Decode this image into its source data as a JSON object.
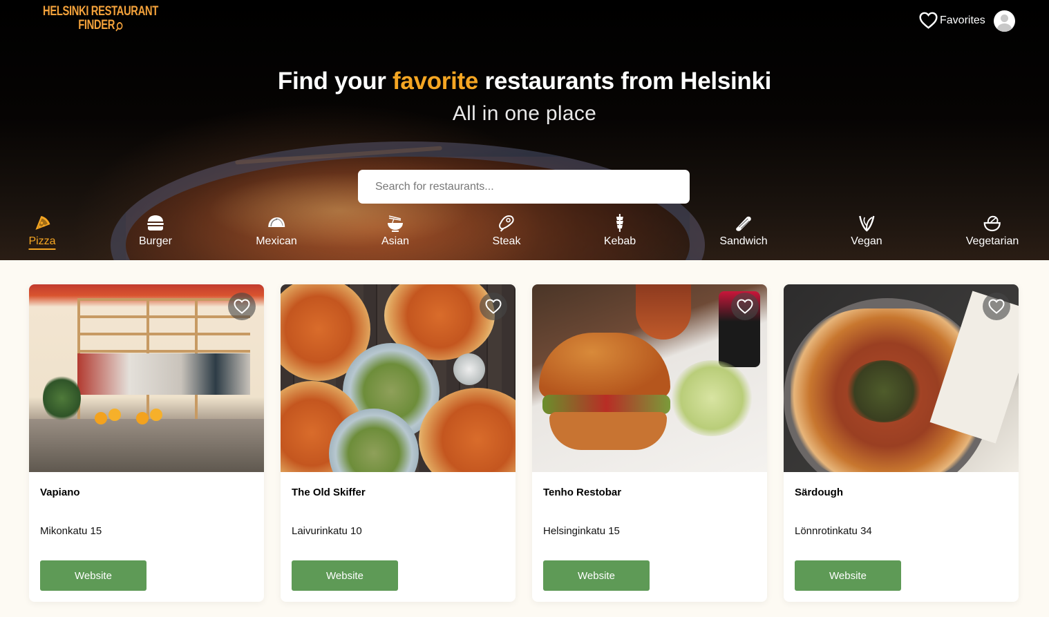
{
  "header": {
    "logo_line1": "HELSINKI RESTAURANT",
    "logo_line2": "FINDER",
    "favorites_label": "Favorites"
  },
  "hero": {
    "title_before": "Find your ",
    "title_accent": "favorite",
    "title_after": " restaurants from Helsinki",
    "subtitle": "All in one place",
    "search_placeholder": "Search for restaurants...",
    "search_value": ""
  },
  "categories": [
    {
      "label": "Pizza",
      "icon": "pizza-icon",
      "active": true
    },
    {
      "label": "Burger",
      "icon": "burger-icon",
      "active": false
    },
    {
      "label": "Mexican",
      "icon": "taco-icon",
      "active": false
    },
    {
      "label": "Asian",
      "icon": "noodle-bowl-icon",
      "active": false
    },
    {
      "label": "Steak",
      "icon": "steak-icon",
      "active": false
    },
    {
      "label": "Kebab",
      "icon": "kebab-icon",
      "active": false
    },
    {
      "label": "Sandwich",
      "icon": "sandwich-icon",
      "active": false
    },
    {
      "label": "Vegan",
      "icon": "vegan-leaf-icon",
      "active": false
    },
    {
      "label": "Vegetarian",
      "icon": "salad-bowl-icon",
      "active": false
    }
  ],
  "restaurants": [
    {
      "name": "Vapiano",
      "address": "Mikonkatu 15",
      "button": "Website"
    },
    {
      "name": "The Old Skiffer",
      "address": "Laivurinkatu 10",
      "button": "Website"
    },
    {
      "name": "Tenho Restobar",
      "address": "Helsinginkatu 15",
      "button": "Website"
    },
    {
      "name": "Särdough",
      "address": "Lönnrotinkatu 34",
      "button": "Website"
    }
  ],
  "colors": {
    "accent": "#f5a623",
    "button_green": "#5e9a56",
    "page_background": "#fdfaf3"
  }
}
